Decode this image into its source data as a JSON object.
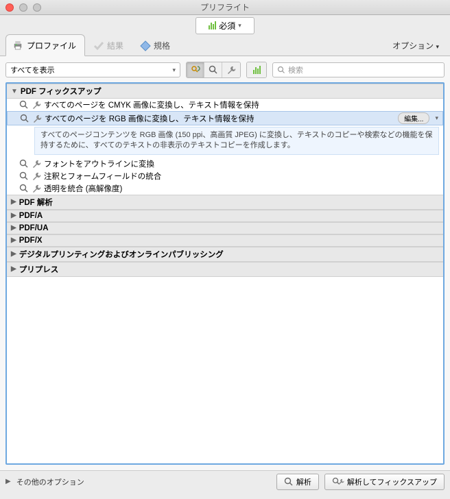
{
  "window": {
    "title": "プリフライト"
  },
  "toolbar": {
    "required_label": "必須"
  },
  "tabs": {
    "profile": "プロファイル",
    "results": "結果",
    "standards": "規格",
    "options": "オプション"
  },
  "filter": {
    "show_all": "すべてを表示",
    "search_placeholder": "検索"
  },
  "groups": {
    "fixup": "PDF フィックスアップ",
    "analysis": "PDF 解析",
    "pdfa": "PDF/A",
    "pdfua": "PDF/UA",
    "pdfx": "PDF/X",
    "digital": "デジタルプリンティングおよびオンラインパブリッシング",
    "prepress": "プリプレス"
  },
  "items": {
    "cmyk": "すべてのページを CMYK 画像に変換し、テキスト情報を保持",
    "rgb": "すべてのページを RGB 画像に変換し、テキスト情報を保持",
    "rgb_desc": "すべてのページコンテンツを RGB 画像 (150 ppi、高画質 JPEG) に変換し、テキストのコピーや検索などの機能を保持するために、すべてのテキストの非表示のテキストコピーを作成します。",
    "font_outline": "フォントをアウトラインに変換",
    "annot_merge": "注釈とフォームフィールドの統合",
    "flatten": "透明を統合 (高解像度)",
    "edit": "編集..."
  },
  "footer": {
    "other_options": "その他のオプション",
    "analyze": "解析",
    "analyze_fix": "解析してフィックスアップ"
  }
}
